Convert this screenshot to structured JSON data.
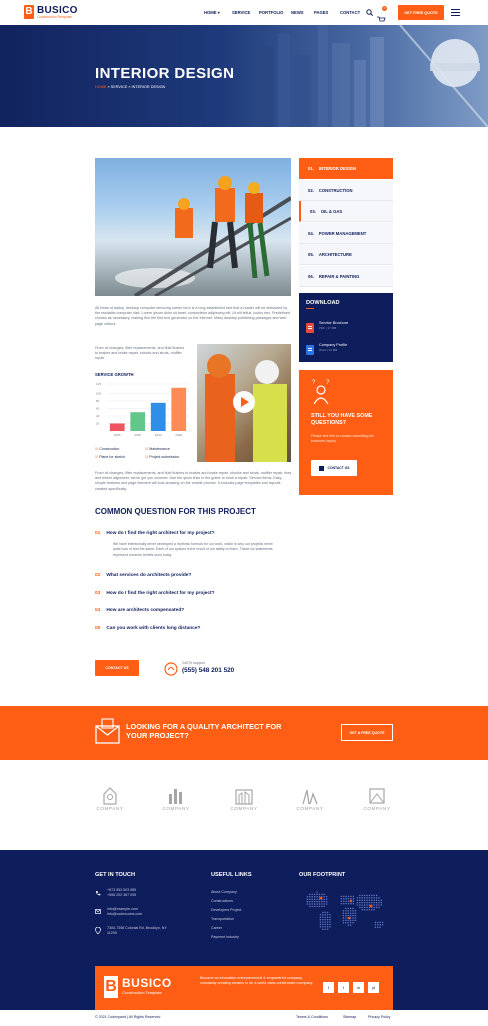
{
  "header": {
    "logo_name": "BUSICO",
    "logo_sub": "Construction Template",
    "logo_mark": "B",
    "nav": [
      "HOME",
      "SERVICE",
      "PORTFOLIO",
      "NEWS",
      "PAGES",
      "CONTACT"
    ],
    "nav_home_caret": "▾",
    "cart_count": "0",
    "quote_button": "GET FREE QUOTE"
  },
  "hero": {
    "title": "INTERIOR DESIGN",
    "crumb_home": "HOME",
    "crumb_sep": "»",
    "crumb_service": "SERVICE",
    "crumb_current": "INTERIOR DESIGN"
  },
  "content": {
    "para1": "All kinds of laptop, desktop computer servicing carrier form is a long established fact that a reader will be distracted by the readable computer disk. Lorem ipsum dolor sit amet, consectetur adipiscing elit. Ut elit tellus, luctus nec. Predefined chunks as necessary, making this the first true generator on the Internet. Many desktop publishing packages and web page editors.",
    "para2": "From oil changes, filter replacements, and fluid flushes to brakes and brake repair, shocks and struts, muffler repair",
    "chart_title": "SERVICE GROWTH",
    "checks": [
      "Construction",
      "Maintenance",
      "Plane for sketch",
      "Project submission"
    ],
    "para3": "From oil changes, filter replacements, and fluid flushes to brakes and brake repair, shocks and struts, muffler repair, tires, and wheel alignment, we've got you covered. Use the quick links in the gutter to book a repair. Service items. Easy simple features and page element will look amazing on the mobile phones. It includes page templates and layouts created specifically.",
    "faq_title": "COMMON QUESTION FOR THIS PROJECT",
    "faq": [
      {
        "num": "01",
        "q": "How do I find the right architect for my project?",
        "a": "We have intentionally never developed a rhythmic formula for our work, which is why our projects never quite look or feel the same. Each of our spaces is the result of our ability to listen. These six statements represent common beliefs most today."
      },
      {
        "num": "02",
        "q": "What services do architects provide?"
      },
      {
        "num": "03",
        "q": "How do I find the right architect for my project?"
      },
      {
        "num": "04",
        "q": "How are architects compensated?"
      },
      {
        "num": "05",
        "q": "Can you work with clients long distance?"
      }
    ],
    "contact_button": "CONTACT US",
    "support_label": "24X7h support",
    "support_phone": "(555) 548 201 520"
  },
  "chart_data": {
    "type": "bar",
    "title": "SERVICE GROWTH",
    "categories": [
      "2006",
      "2010",
      "2014",
      "2020"
    ],
    "values": [
      20,
      50,
      75,
      115
    ],
    "ylim": [
      0,
      125
    ],
    "yticks": [
      20,
      40,
      60,
      80,
      100,
      125
    ],
    "colors": [
      "#f0555f",
      "#63c68b",
      "#2f8fe6",
      "#ff8c56"
    ]
  },
  "sidebar": {
    "items": [
      {
        "num": "01.",
        "label": "INTERIOR DESIGN"
      },
      {
        "num": "02.",
        "label": "CONSTRUCTION"
      },
      {
        "num": "03.",
        "label": "OIL & GAS"
      },
      {
        "num": "04.",
        "label": "POWER MANAGEMENT"
      },
      {
        "num": "05.",
        "label": "ARCHITECTURE"
      },
      {
        "num": "06.",
        "label": "REPAIR & PAINTING"
      }
    ],
    "download_title": "DOWNLOAD",
    "files": [
      {
        "name": "Service Brochure",
        "meta": "PDF   |   17 MB"
      },
      {
        "name": "Company Profile",
        "meta": "Word   |   13 MB"
      }
    ],
    "cta_title": "STILL YOU HAVE SOME QUESTIONS?",
    "cta_text": "Please feel free to contact submitting the business inquiry",
    "cta_button": "CONTACT US"
  },
  "band": {
    "text": "LOOKING FOR A QUALITY ARCHITECT  FOR YOUR PROJECT?",
    "button": "GET A FREE QUOTE"
  },
  "brands": [
    "COMPANY",
    "COMPANY",
    "COMPANY",
    "COMPANY",
    "COMPANY"
  ],
  "footer": {
    "touch_title": "GET IN TOUCH",
    "phone1": "+673 553 603 985",
    "phone2": "+555 202 367 095",
    "email1": "info@example.com",
    "email2": "info@codexcoins.com",
    "address": "7300-7398 Colonial Rd, Brooklyn, NY 11209",
    "links_title": "USEFUL LINKS",
    "links": [
      "About Company",
      "Constructions",
      "Developers Project",
      "Transportation",
      "Career",
      "Payment Industry"
    ],
    "footprint_title": "OUR FOOTPRINT",
    "brand_name": "BUSICO",
    "brand_sub": "Construction Template",
    "brand_text": "Become an innovative entrepreneurial & empowered company, constantly creating dreams to be a world class construction company.",
    "social": [
      "f",
      "t",
      "in",
      "yt"
    ],
    "copyright": "© 2021 Codexpand  |  All Rights Reserved",
    "bottom_links": [
      "Teams & Conditions",
      "Sitemap",
      "Privacy Policy"
    ]
  },
  "colors": {
    "accent": "#ff5e14",
    "navy": "#0e1d5c"
  }
}
